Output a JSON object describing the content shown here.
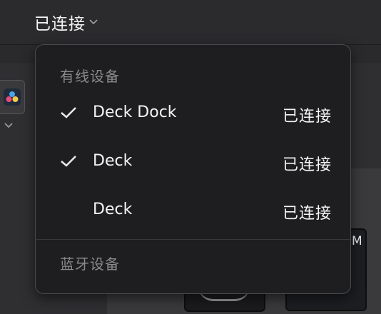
{
  "header": {
    "connection_label": "已连接"
  },
  "background": {
    "key_label": "M"
  },
  "menu": {
    "wired_title": "有线设备",
    "bluetooth_title": "蓝牙设备",
    "wired_devices": [
      {
        "name": "Deck Dock",
        "status": "已连接",
        "checked": true
      },
      {
        "name": "Deck",
        "status": "已连接",
        "checked": true
      },
      {
        "name": "Deck",
        "status": "已连接",
        "checked": false
      }
    ]
  },
  "colors": {
    "menu_bg": "#1e1e20",
    "text": "#f4f4f4",
    "section": "#8a8a8c"
  }
}
